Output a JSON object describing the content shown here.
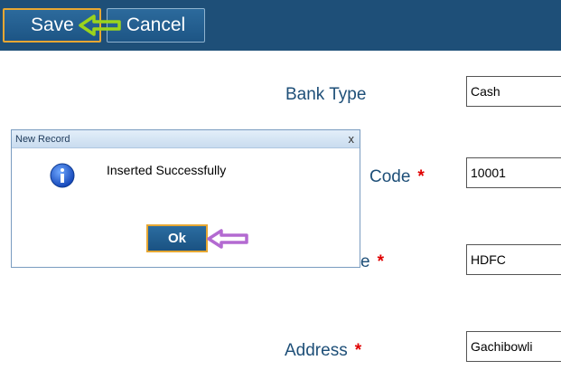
{
  "toolbar": {
    "save_label": "Save",
    "cancel_label": "Cancel"
  },
  "form": {
    "bank_type_label": "Bank Type",
    "bank_type_value": "Cash",
    "code_label": "Code",
    "code_value": "10001",
    "name_label": "e",
    "name_value": "HDFC",
    "address_label": "Address",
    "address_value": "Gachibowli",
    "required_mark": "*"
  },
  "dialog": {
    "title": "New Record",
    "close_glyph": "x",
    "message": "Inserted Successfully",
    "ok_label": "Ok"
  },
  "colors": {
    "toolbar_bg": "#1e4f78",
    "label_text": "#1e4f78",
    "required": "#e00000",
    "highlight_border": "#e6a733",
    "save_arrow": "#9bd41c",
    "ok_arrow": "#b36ad1"
  }
}
